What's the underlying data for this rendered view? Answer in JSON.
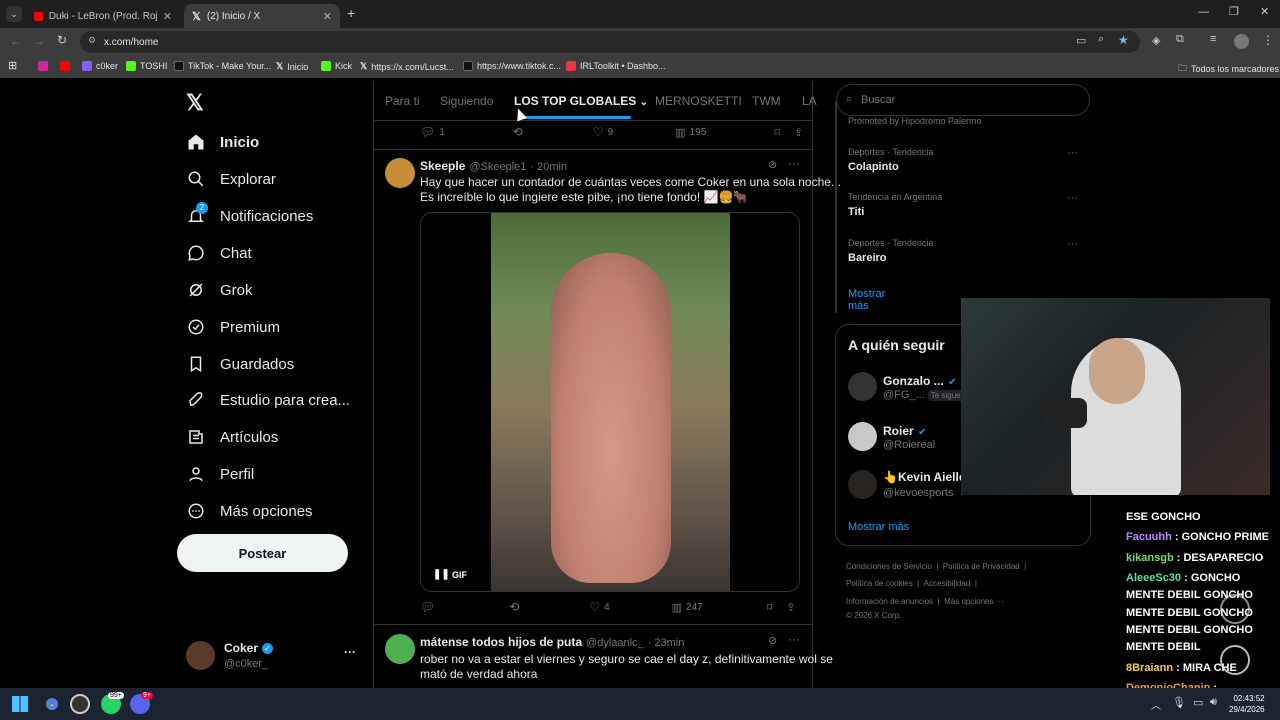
{
  "browser": {
    "tabs": [
      {
        "title": "Duki - LeBron (Prod. Rojas & D..."
      },
      {
        "title": "(2) Inicio / X"
      }
    ],
    "url": "x.com/home",
    "bookmarks": [
      "c0ker",
      "TOSHI",
      "TikTok - Make Your...",
      "Inicio",
      "Kick",
      "https://x.com/Lucst...",
      "https://www.tiktok.c...",
      "IRLToolkit • Dashbo..."
    ],
    "bookmarks_folder": "Todos los marcadores"
  },
  "sidebar": {
    "items": [
      {
        "label": "Inicio",
        "icon": "home-icon"
      },
      {
        "label": "Explorar",
        "icon": "search-icon"
      },
      {
        "label": "Notificaciones",
        "icon": "bell-icon",
        "badge": "2"
      },
      {
        "label": "Chat",
        "icon": "chat-icon"
      },
      {
        "label": "Grok",
        "icon": "grok-icon"
      },
      {
        "label": "Premium",
        "icon": "premium-icon"
      },
      {
        "label": "Guardados",
        "icon": "bookmark-icon"
      },
      {
        "label": "Estudio para crea...",
        "icon": "rocket-icon"
      },
      {
        "label": "Artículos",
        "icon": "articles-icon"
      },
      {
        "label": "Perfil",
        "icon": "profile-icon"
      },
      {
        "label": "Más opciones",
        "icon": "more-circle-icon"
      }
    ],
    "post_button": "Postear",
    "account": {
      "name": "Coker",
      "handle": "@c0ker_",
      "more": "···"
    }
  },
  "feed": {
    "tabs": [
      "Para ti",
      "Siguiendo",
      "LOS TOP GLOBALES",
      "MERNOSKETTI",
      "TWM",
      "LA"
    ],
    "prev_actions": {
      "replies": "1",
      "likes": "9",
      "views": "195"
    },
    "tweets": [
      {
        "name": "Skeeple",
        "handle": "@Skeeple1",
        "time": "· 20min",
        "text_line1": "Hay que hacer un contador de cuántas veces come Coker en una sola noche...",
        "text_line2": "Es increíble lo que ingiere este pibe, ¡no tiene fondo! 📈🍔🐂",
        "media_badge": "GIF",
        "likes": "4",
        "views": "247"
      },
      {
        "name": "mátense todos hijos de puta",
        "handle": "@dylaanlc_",
        "time": "· 23min",
        "text_line1": "rober no va a estar el viernes y seguro se cae el day z, definitivamente wol se",
        "text_line2": "mató de verdad ahora"
      }
    ]
  },
  "right": {
    "search_placeholder": "Buscar",
    "promoted": "Promoted by Hipodromo Palermo",
    "trends": [
      {
        "category": "Deportes · Tendencia",
        "name": "Colapinto"
      },
      {
        "category": "Tendencia en Argentina",
        "name": "Titi"
      },
      {
        "category": "Deportes · Tendencia",
        "name": "Bareiro"
      }
    ],
    "show_more": "Mostrar más",
    "who_to_follow": {
      "title": "A quién seguir",
      "accounts": [
        {
          "name": "Gonzalo ...",
          "handle": "@FG_...",
          "follows_you": "Te sigue"
        },
        {
          "name": "Roier",
          "handle": "@Roierеal"
        },
        {
          "name": "👆Kevin Aiello",
          "handle": "@kevoesports"
        }
      ],
      "show_more": "Mostrar más"
    },
    "footer": {
      "links1": [
        "Condiciones de Servicio",
        "Política de Privacidad"
      ],
      "links2": [
        "Política de cookies",
        "Accesibilidad"
      ],
      "links3": [
        "Información de anuncios",
        "Más opciones ···"
      ],
      "copyright": "© 2026 X Corp."
    }
  },
  "stream_chat": [
    {
      "user": "",
      "msg": "ESE GONCHO",
      "color": "#ffffff"
    },
    {
      "user": "Facuuhh",
      "msg": ": GONCHO PRIME",
      "color": "#b98bff"
    },
    {
      "user": "kikansgb",
      "msg": ": DESAPARECIO",
      "color": "#7ad96b"
    },
    {
      "user": "AleeeSc30",
      "msg": ": GONCHO",
      "color": "#5fe0a0"
    },
    {
      "user": "",
      "msg": "MENTE DEBIL GONCHO",
      "color": "#ffffff"
    },
    {
      "user": "",
      "msg": "MENTE DEBIL GONCHO",
      "color": "#ffffff"
    },
    {
      "user": "",
      "msg": "MENTE DEBIL GONCHO",
      "color": "#ffffff"
    },
    {
      "user": "",
      "msg": "MENTE DEBIL",
      "color": "#ffffff"
    },
    {
      "user": "8Braiann",
      "msg": ": MIRA CHE",
      "color": "#f0c850"
    },
    {
      "user": "DemonioChapin",
      "msg": ":",
      "color": "#f0a030"
    }
  ],
  "taskbar": {
    "time": "02:43:52",
    "date": "29/4/2026",
    "whatsapp_badge": "99+",
    "discord_badge": "9+"
  }
}
